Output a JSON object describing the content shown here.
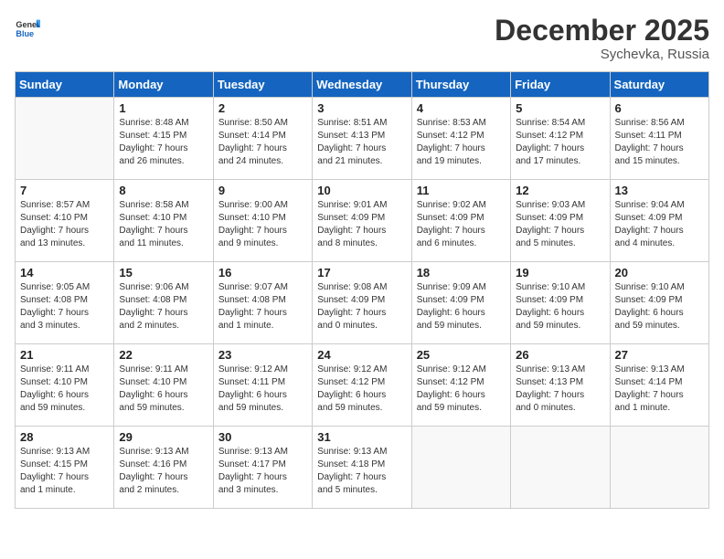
{
  "header": {
    "logo_general": "General",
    "logo_blue": "Blue",
    "month_title": "December 2025",
    "location": "Sychevka, Russia"
  },
  "days_of_week": [
    "Sunday",
    "Monday",
    "Tuesday",
    "Wednesday",
    "Thursday",
    "Friday",
    "Saturday"
  ],
  "weeks": [
    [
      {
        "day": "",
        "info": ""
      },
      {
        "day": "1",
        "info": "Sunrise: 8:48 AM\nSunset: 4:15 PM\nDaylight: 7 hours\nand 26 minutes."
      },
      {
        "day": "2",
        "info": "Sunrise: 8:50 AM\nSunset: 4:14 PM\nDaylight: 7 hours\nand 24 minutes."
      },
      {
        "day": "3",
        "info": "Sunrise: 8:51 AM\nSunset: 4:13 PM\nDaylight: 7 hours\nand 21 minutes."
      },
      {
        "day": "4",
        "info": "Sunrise: 8:53 AM\nSunset: 4:12 PM\nDaylight: 7 hours\nand 19 minutes."
      },
      {
        "day": "5",
        "info": "Sunrise: 8:54 AM\nSunset: 4:12 PM\nDaylight: 7 hours\nand 17 minutes."
      },
      {
        "day": "6",
        "info": "Sunrise: 8:56 AM\nSunset: 4:11 PM\nDaylight: 7 hours\nand 15 minutes."
      }
    ],
    [
      {
        "day": "7",
        "info": "Sunrise: 8:57 AM\nSunset: 4:10 PM\nDaylight: 7 hours\nand 13 minutes."
      },
      {
        "day": "8",
        "info": "Sunrise: 8:58 AM\nSunset: 4:10 PM\nDaylight: 7 hours\nand 11 minutes."
      },
      {
        "day": "9",
        "info": "Sunrise: 9:00 AM\nSunset: 4:10 PM\nDaylight: 7 hours\nand 9 minutes."
      },
      {
        "day": "10",
        "info": "Sunrise: 9:01 AM\nSunset: 4:09 PM\nDaylight: 7 hours\nand 8 minutes."
      },
      {
        "day": "11",
        "info": "Sunrise: 9:02 AM\nSunset: 4:09 PM\nDaylight: 7 hours\nand 6 minutes."
      },
      {
        "day": "12",
        "info": "Sunrise: 9:03 AM\nSunset: 4:09 PM\nDaylight: 7 hours\nand 5 minutes."
      },
      {
        "day": "13",
        "info": "Sunrise: 9:04 AM\nSunset: 4:09 PM\nDaylight: 7 hours\nand 4 minutes."
      }
    ],
    [
      {
        "day": "14",
        "info": "Sunrise: 9:05 AM\nSunset: 4:08 PM\nDaylight: 7 hours\nand 3 minutes."
      },
      {
        "day": "15",
        "info": "Sunrise: 9:06 AM\nSunset: 4:08 PM\nDaylight: 7 hours\nand 2 minutes."
      },
      {
        "day": "16",
        "info": "Sunrise: 9:07 AM\nSunset: 4:08 PM\nDaylight: 7 hours\nand 1 minute."
      },
      {
        "day": "17",
        "info": "Sunrise: 9:08 AM\nSunset: 4:09 PM\nDaylight: 7 hours\nand 0 minutes."
      },
      {
        "day": "18",
        "info": "Sunrise: 9:09 AM\nSunset: 4:09 PM\nDaylight: 6 hours\nand 59 minutes."
      },
      {
        "day": "19",
        "info": "Sunrise: 9:10 AM\nSunset: 4:09 PM\nDaylight: 6 hours\nand 59 minutes."
      },
      {
        "day": "20",
        "info": "Sunrise: 9:10 AM\nSunset: 4:09 PM\nDaylight: 6 hours\nand 59 minutes."
      }
    ],
    [
      {
        "day": "21",
        "info": "Sunrise: 9:11 AM\nSunset: 4:10 PM\nDaylight: 6 hours\nand 59 minutes."
      },
      {
        "day": "22",
        "info": "Sunrise: 9:11 AM\nSunset: 4:10 PM\nDaylight: 6 hours\nand 59 minutes."
      },
      {
        "day": "23",
        "info": "Sunrise: 9:12 AM\nSunset: 4:11 PM\nDaylight: 6 hours\nand 59 minutes."
      },
      {
        "day": "24",
        "info": "Sunrise: 9:12 AM\nSunset: 4:12 PM\nDaylight: 6 hours\nand 59 minutes."
      },
      {
        "day": "25",
        "info": "Sunrise: 9:12 AM\nSunset: 4:12 PM\nDaylight: 6 hours\nand 59 minutes."
      },
      {
        "day": "26",
        "info": "Sunrise: 9:13 AM\nSunset: 4:13 PM\nDaylight: 7 hours\nand 0 minutes."
      },
      {
        "day": "27",
        "info": "Sunrise: 9:13 AM\nSunset: 4:14 PM\nDaylight: 7 hours\nand 1 minute."
      }
    ],
    [
      {
        "day": "28",
        "info": "Sunrise: 9:13 AM\nSunset: 4:15 PM\nDaylight: 7 hours\nand 1 minute."
      },
      {
        "day": "29",
        "info": "Sunrise: 9:13 AM\nSunset: 4:16 PM\nDaylight: 7 hours\nand 2 minutes."
      },
      {
        "day": "30",
        "info": "Sunrise: 9:13 AM\nSunset: 4:17 PM\nDaylight: 7 hours\nand 3 minutes."
      },
      {
        "day": "31",
        "info": "Sunrise: 9:13 AM\nSunset: 4:18 PM\nDaylight: 7 hours\nand 5 minutes."
      },
      {
        "day": "",
        "info": ""
      },
      {
        "day": "",
        "info": ""
      },
      {
        "day": "",
        "info": ""
      }
    ]
  ]
}
